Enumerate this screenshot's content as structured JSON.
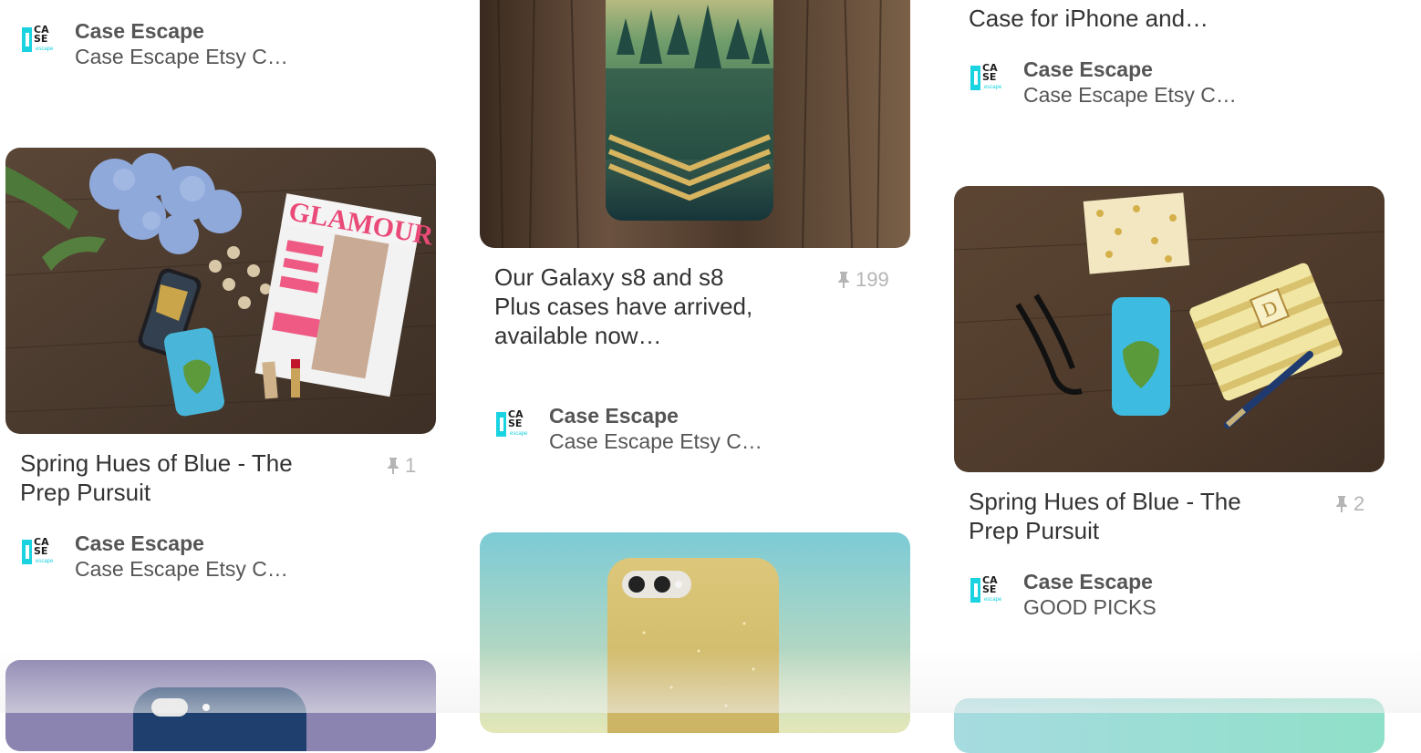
{
  "col1": {
    "top_attribution": {
      "name": "Case Escape",
      "board": "Case Escape Etsy C…"
    },
    "pin": {
      "title": "Spring Hues of Blue - The Prep Pursuit",
      "save_count": "1",
      "attribution": {
        "name": "Case Escape",
        "board": "Case Escape Etsy C…"
      }
    }
  },
  "col2": {
    "pin": {
      "title": "Our Galaxy s8 and s8 Plus cases have arrived, available now…",
      "save_count": "199",
      "attribution": {
        "name": "Case Escape",
        "board": "Case Escape Etsy C…"
      }
    }
  },
  "col3": {
    "top_title": "Case for iPhone and…",
    "top_attribution": {
      "name": "Case Escape",
      "board": "Case Escape Etsy C…"
    },
    "pin": {
      "title": "Spring Hues of Blue - The Prep Pursuit",
      "save_count": "2",
      "attribution": {
        "name": "Case Escape",
        "board": "GOOD PICKS"
      }
    }
  },
  "logo": {
    "line1": "CA",
    "line2": "SE",
    "sub": "escape"
  },
  "icons": {
    "save": "pushpin-icon"
  },
  "colors": {
    "brand": "#19d3e0",
    "text": "#333333",
    "muted": "#b5b5b5"
  }
}
